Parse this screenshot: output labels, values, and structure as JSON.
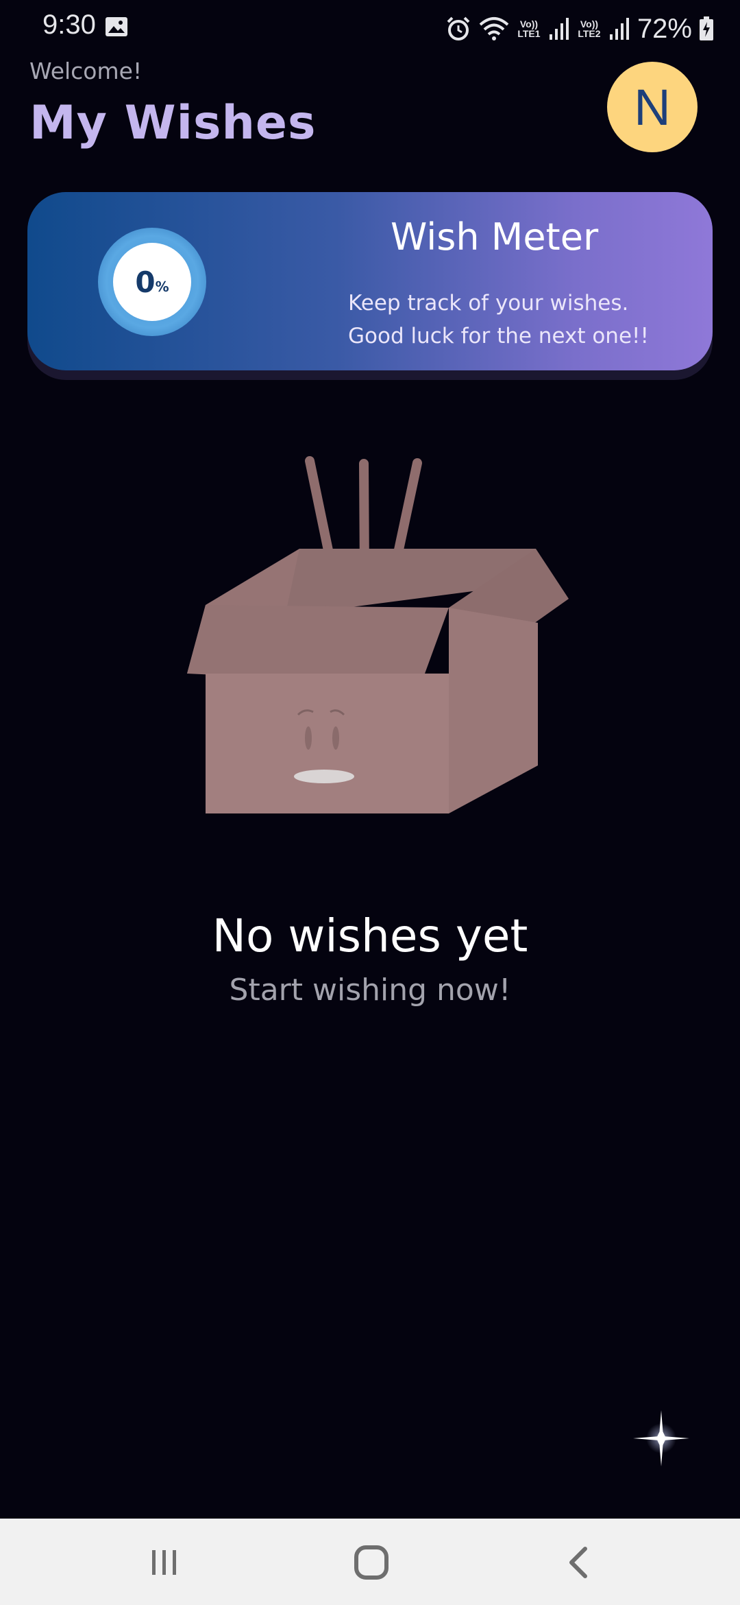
{
  "status_bar": {
    "time": "9:30",
    "battery": "72%",
    "sim1_label": "Vo)) LTE1",
    "sim2_label": "Vo)) LTE2"
  },
  "header": {
    "welcome": "Welcome!",
    "title": "My Wishes",
    "avatar_initial": "N"
  },
  "wish_meter": {
    "value": "0",
    "unit": "%",
    "title": "Wish Meter",
    "line1": "Keep track of your wishes.",
    "line2": "Good luck for the next one!!"
  },
  "empty_state": {
    "title": "No wishes yet",
    "subtitle": "Start wishing now!"
  },
  "icons": {
    "fab": "sparkle-icon",
    "nav": [
      "recent-apps-icon",
      "home-icon",
      "back-icon"
    ]
  },
  "colors": {
    "background": "#04030f",
    "title": "#c4b6ee",
    "avatar": "#fdd57e",
    "box": "#a27f7f"
  }
}
